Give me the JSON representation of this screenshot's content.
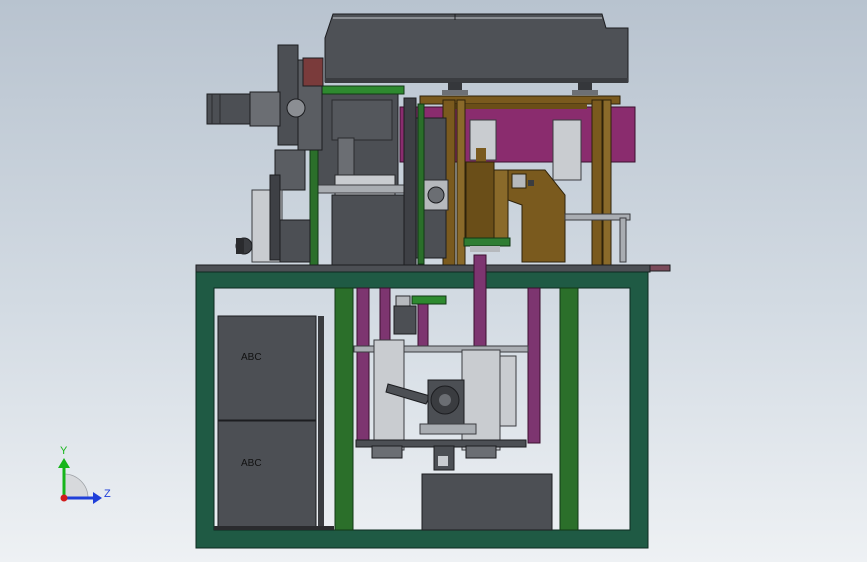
{
  "model": {
    "cabinet_labels": [
      "ABC",
      "ABC"
    ]
  },
  "triad": {
    "y_label": "Y",
    "z_label": "Z",
    "y_color": "#16b51a",
    "z_color": "#1f3fd9",
    "origin_color": "#d11b1b"
  },
  "colors": {
    "background_top": "#b8c3cf",
    "frame_green": "#1f5a44",
    "column_green": "#2b6f2a",
    "machine_gray": "#4c4f54",
    "light_gray": "#a9adb2",
    "fixture_tan": "#7a5a1e",
    "magenta": "#8a2c6e",
    "purple_rod": "#7d3570"
  }
}
